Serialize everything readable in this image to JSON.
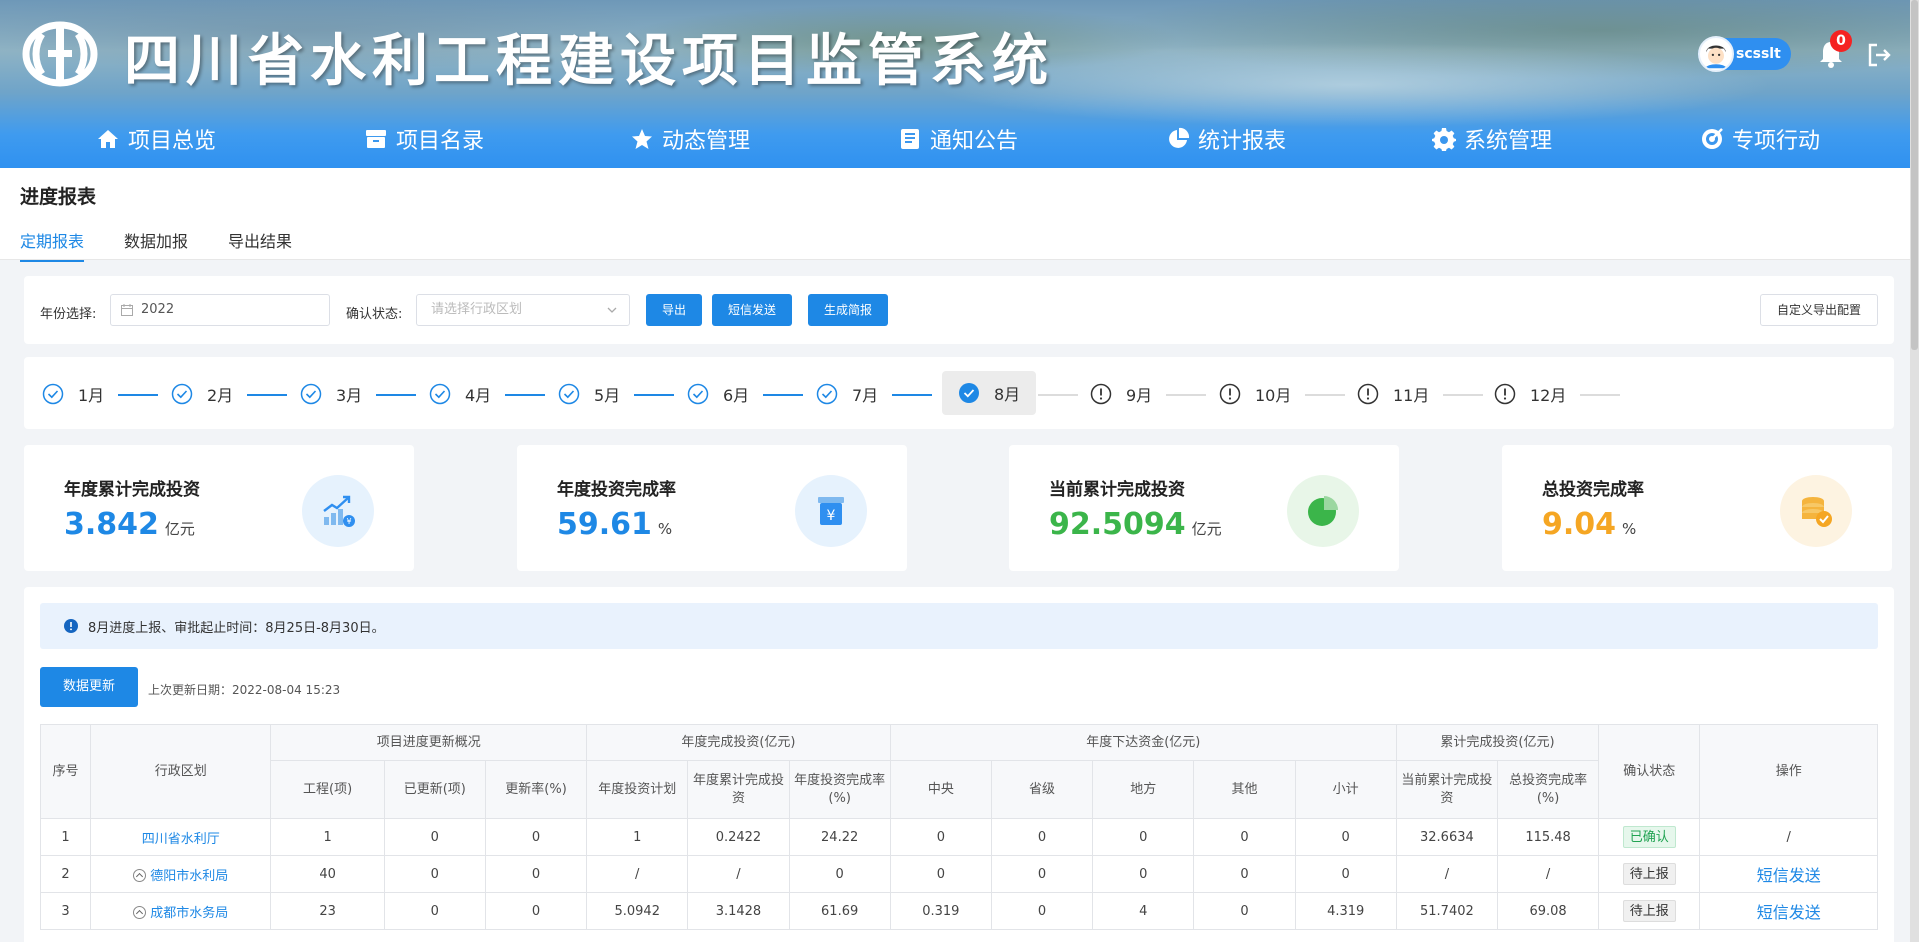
{
  "header": {
    "title": "四川省水利工程建设项目监管系统",
    "username": "scsslt",
    "notification_count": "0"
  },
  "nav": [
    {
      "label": "项目总览",
      "icon": "home-icon"
    },
    {
      "label": "项目名录",
      "icon": "archive-icon"
    },
    {
      "label": "动态管理",
      "icon": "star-icon"
    },
    {
      "label": "通知公告",
      "icon": "notebook-icon"
    },
    {
      "label": "统计报表",
      "icon": "pie-chart-icon"
    },
    {
      "label": "系统管理",
      "icon": "gear-icon"
    },
    {
      "label": "专项行动",
      "icon": "target-icon"
    }
  ],
  "page": {
    "title": "进度报表",
    "tabs": [
      "定期报表",
      "数据加报",
      "导出结果"
    ],
    "active_tab": "定期报表"
  },
  "filters": {
    "year_label": "年份选择:",
    "year_value": "2022",
    "status_label": "确认状态:",
    "status_placeholder": "请选择行政区划",
    "export_btn": "导出",
    "sms_btn": "短信发送",
    "brief_btn": "生成简报",
    "custom_export_btn": "自定义导出配置"
  },
  "months": [
    {
      "label": "1月",
      "state": "done"
    },
    {
      "label": "2月",
      "state": "done"
    },
    {
      "label": "3月",
      "state": "done"
    },
    {
      "label": "4月",
      "state": "done"
    },
    {
      "label": "5月",
      "state": "done"
    },
    {
      "label": "6月",
      "state": "done"
    },
    {
      "label": "7月",
      "state": "done"
    },
    {
      "label": "8月",
      "state": "current"
    },
    {
      "label": "9月",
      "state": "pending"
    },
    {
      "label": "10月",
      "state": "pending"
    },
    {
      "label": "11月",
      "state": "pending"
    },
    {
      "label": "12月",
      "state": "pending"
    }
  ],
  "stats": [
    {
      "label": "年度累计完成投资",
      "value": "3.842",
      "unit": "亿元",
      "color": "#1e88e5",
      "icon": "growth-chart-icon"
    },
    {
      "label": "年度投资完成率",
      "value": "59.61",
      "unit": "%",
      "color": "#1e88e5",
      "icon": "yuan-box-icon"
    },
    {
      "label": "当前累计完成投资",
      "value": "92.5094",
      "unit": "亿元",
      "color": "#3bb54a",
      "icon": "pie-icon"
    },
    {
      "label": "总投资完成率",
      "value": "9.04",
      "unit": "%",
      "color": "#f5a623",
      "icon": "coins-check-icon"
    }
  ],
  "notice": "8月进度上报、审批起止时间：8月25日-8月30日。",
  "update": {
    "button": "数据更新",
    "last_date": "上次更新日期：2022-08-04 15:23"
  },
  "table": {
    "headers": {
      "index": "序号",
      "region": "行政区划",
      "group_progress": "项目进度更新概况",
      "group_annual": "年度完成投资(亿元)",
      "group_funds": "年度下达资金(亿元)",
      "group_cumulative": "累计完成投资(亿元)",
      "status": "确认状态",
      "action": "操作",
      "projects": "工程(项)",
      "updated": "已更新(项)",
      "update_rate": "更新率(%)",
      "annual_plan": "年度投资计划",
      "annual_done": "年度累计完成投资",
      "annual_rate": "年度投资完成率(%)",
      "central": "中央",
      "provincial": "省级",
      "local": "地方",
      "other": "其他",
      "subtotal": "小计",
      "current_cum": "当前累计完成投资",
      "total_rate": "总投资完成率(%)"
    },
    "rows": [
      {
        "idx": "1",
        "region": "四川省水利厅",
        "expandable": false,
        "projects": "1",
        "updated": "0",
        "rate": "0",
        "plan": "1",
        "done": "0.2422",
        "annual_rate": "24.22",
        "central": "0",
        "provincial": "0",
        "local": "0",
        "other": "0",
        "subtotal": "0",
        "cum": "32.6634",
        "total_rate": "115.48",
        "status": "已确认",
        "status_type": "ok",
        "action": "/"
      },
      {
        "idx": "2",
        "region": "德阳市水利局",
        "expandable": true,
        "projects": "40",
        "updated": "0",
        "rate": "0",
        "plan": "/",
        "done": "/",
        "annual_rate": "0",
        "central": "0",
        "provincial": "0",
        "local": "0",
        "other": "0",
        "subtotal": "0",
        "cum": "/",
        "total_rate": "/",
        "status": "待上报",
        "status_type": "wait",
        "action": "短信发送"
      },
      {
        "idx": "3",
        "region": "成都市水务局",
        "expandable": true,
        "projects": "23",
        "updated": "0",
        "rate": "0",
        "plan": "5.0942",
        "done": "3.1428",
        "annual_rate": "61.69",
        "central": "0.319",
        "provincial": "0",
        "local": "4",
        "other": "0",
        "subtotal": "4.319",
        "cum": "51.7402",
        "total_rate": "69.08",
        "status": "待上报",
        "status_type": "wait",
        "action": "短信发送"
      }
    ]
  }
}
